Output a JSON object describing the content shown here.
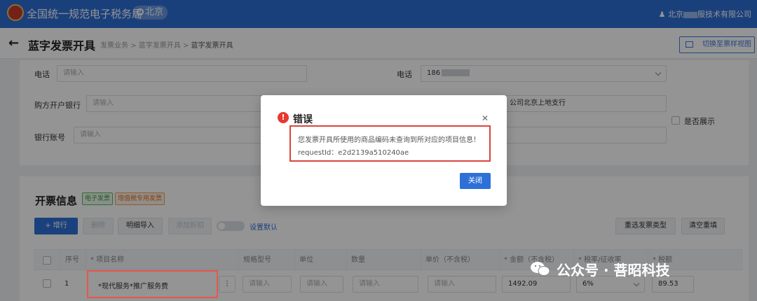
{
  "topbar": {
    "site_title": "全国统一规范电子税务局",
    "location": "北京",
    "user_prefix": "北京",
    "user_suffix": "服技术有限公司"
  },
  "subhead": {
    "page_title": "蓝字发票开具",
    "breadcrumb": [
      "发票业务",
      "蓝字发票开具",
      "蓝字发票开具"
    ],
    "breadcrumb_sep": ">",
    "switch_button": "切换至票样视图"
  },
  "buyer_form": {
    "phone_label": "电话",
    "phone_placeholder": "请输入",
    "bank_label": "购方开户银行",
    "bank_placeholder": "请输入",
    "account_label": "银行账号",
    "account_placeholder": "请输入"
  },
  "seller_form": {
    "phone_label": "电话",
    "phone_value": "186",
    "bank_value": "公司北京上地支行",
    "show_checkbox_label": "是否展示"
  },
  "invoice_section": {
    "title": "开票信息",
    "tag_digital": "电子发票",
    "tag_special": "增值税专用发票",
    "add_row": "+  增行",
    "delete": "删除",
    "detail_import": "明细导入",
    "add_discount": "添加折扣",
    "set_default": "设置默认",
    "reselect_type": "重选发票类型",
    "clear_refill": "清空重填"
  },
  "table": {
    "headers": [
      "序号",
      "* 项目名称",
      "规格型号",
      "单位",
      "数量",
      "单价（不含税）",
      "* 金额（不含税）",
      "* 税率/征收率",
      "* 税额"
    ],
    "row": {
      "index": "1",
      "item_name": "*现代服务*推广服务费",
      "spec_placeholder": "请输入",
      "unit_placeholder": "请输入",
      "qty_placeholder": "请输入",
      "price_placeholder": "请输入",
      "amount": "1492.09",
      "tax_rate": "6%",
      "tax": "89.53"
    }
  },
  "dialog": {
    "title": "错误",
    "message": "您发票开具所使用的商品编码未查询到所对应的项目信息！",
    "request_id": "requestId：e2d2139a510240ae",
    "close_button": "关闭"
  },
  "watermark": {
    "text": "公众号 · 菩昭科技"
  },
  "colors": {
    "primary_blue": "#2e70d8",
    "error_red": "#e8382f",
    "highlight_red": "#e8564c"
  }
}
